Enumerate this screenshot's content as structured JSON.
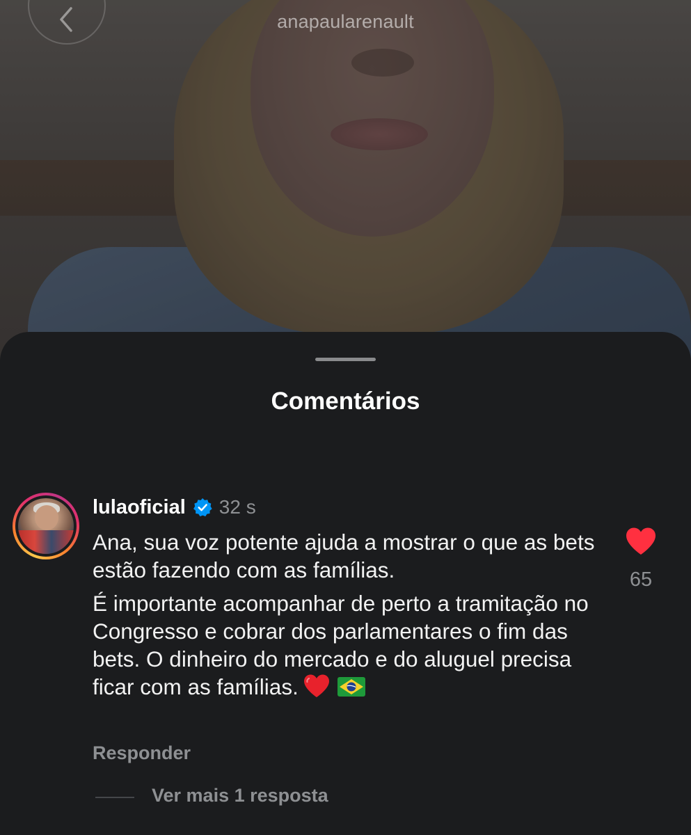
{
  "video": {
    "username": "anapaularenault"
  },
  "sheet": {
    "title": "Comentários"
  },
  "comment": {
    "username": "lulaoficial",
    "verified": true,
    "timestamp": "32 s",
    "paragraphs": [
      "Ana, sua voz potente ajuda a mostrar o que as bets estão fazendo com as famílias.",
      "É importante acompanhar de perto a tramitação no Congresso e cobrar dos parlamentares o fim das bets. O dinheiro do mercado e do aluguel precisa ficar com as famílias."
    ],
    "emojis": [
      "red-heart-emoji",
      "brazil-flag-emoji"
    ],
    "likes": "65",
    "liked": true,
    "reply_label": "Responder",
    "view_replies_label": "Ver mais 1 resposta"
  },
  "colors": {
    "sheet_bg": "#1b1c1e",
    "like_red": "#ff3040",
    "verified_blue": "#0095f6",
    "muted_text": "#8e9093"
  }
}
